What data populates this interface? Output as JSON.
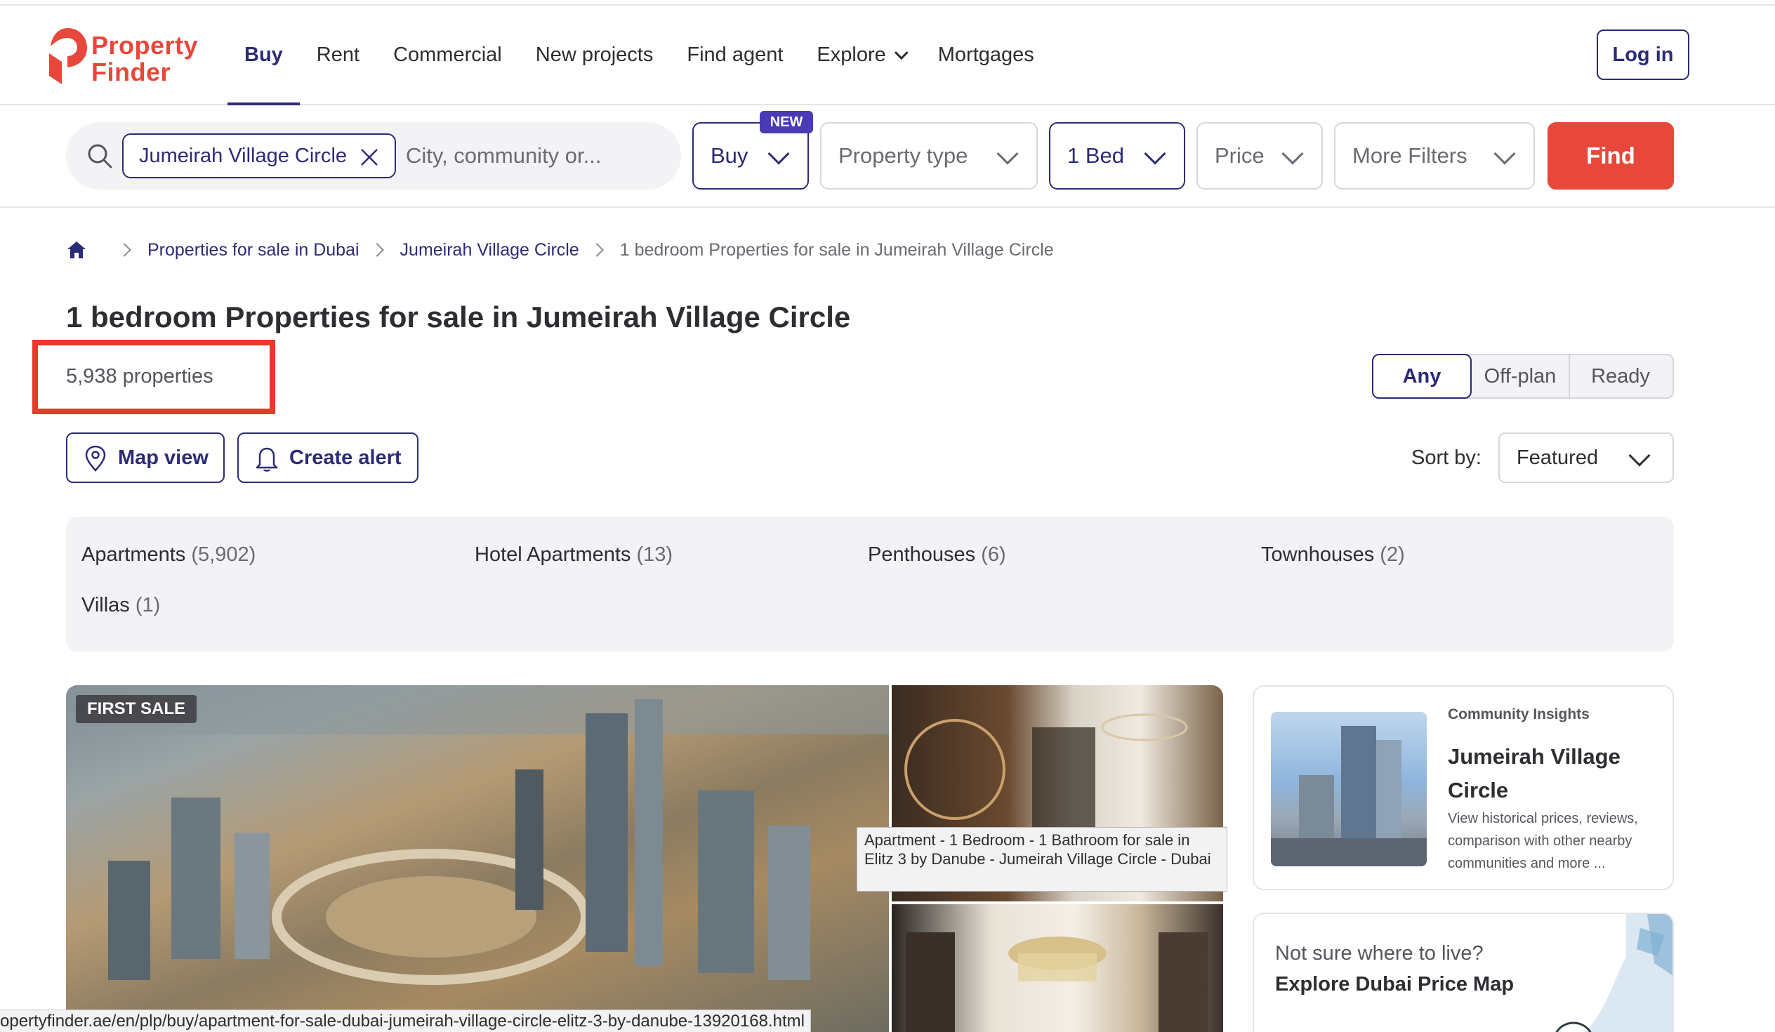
{
  "brand": {
    "name_line1": "Property",
    "name_line2": "Finder",
    "color": "#e8473b"
  },
  "nav": {
    "items": [
      {
        "label": "Buy",
        "active": true
      },
      {
        "label": "Rent"
      },
      {
        "label": "Commercial"
      },
      {
        "label": "New projects"
      },
      {
        "label": "Find agent"
      },
      {
        "label": "Explore",
        "has_dropdown": true
      },
      {
        "label": "Mortgages"
      }
    ],
    "login_label": "Log in"
  },
  "search": {
    "chip_label": "Jumeirah Village Circle",
    "placeholder": "City, community or...",
    "new_badge": "NEW",
    "filters": {
      "buy": "Buy",
      "property_type": "Property type",
      "bed": "1 Bed",
      "price": "Price",
      "more": "More Filters"
    },
    "find_label": "Find"
  },
  "breadcrumb": {
    "items": [
      "Properties for sale in Dubai",
      "Jumeirah Village Circle"
    ],
    "current": "1 bedroom Properties for sale in Jumeirah Village Circle"
  },
  "results": {
    "title": "1 bedroom Properties for sale in Jumeirah Village Circle",
    "count": "5,938 properties",
    "completion": {
      "any": "Any",
      "offplan": "Off-plan",
      "ready": "Ready",
      "selected": "Any"
    },
    "map_view": "Map view",
    "create_alert": "Create alert",
    "sort_label": "Sort by:",
    "sort_value": "Featured"
  },
  "categories": [
    {
      "label": "Apartments",
      "count": "(5,902)"
    },
    {
      "label": "Hotel Apartments",
      "count": "(13)"
    },
    {
      "label": "Penthouses",
      "count": "(6)"
    },
    {
      "label": "Townhouses",
      "count": "(2)"
    },
    {
      "label": "Villas",
      "count": "(1)"
    }
  ],
  "listing": {
    "badge": "FIRST SALE",
    "tooltip": "Apartment - 1 Bedroom - 1 Bathroom for sale in Elitz 3 by Danube - Jumeirah Village Circle - Dubai"
  },
  "insights": {
    "kicker": "Community Insights",
    "title": "Jumeirah Village Circle",
    "description": "View historical prices, reviews, comparison with other nearby communities and more ..."
  },
  "price_map": {
    "question": "Not sure where to live?",
    "cta": "Explore Dubai Price Map"
  },
  "status_bar": {
    "url": "opertyfinder.ae/en/plp/buy/apartment-for-sale-dubai-jumeirah-village-circle-elitz-3-by-danube-13920168.html"
  },
  "colors": {
    "accent": "#2c2b76",
    "brand_red": "#e8473b",
    "highlight_box": "#e8392a"
  }
}
